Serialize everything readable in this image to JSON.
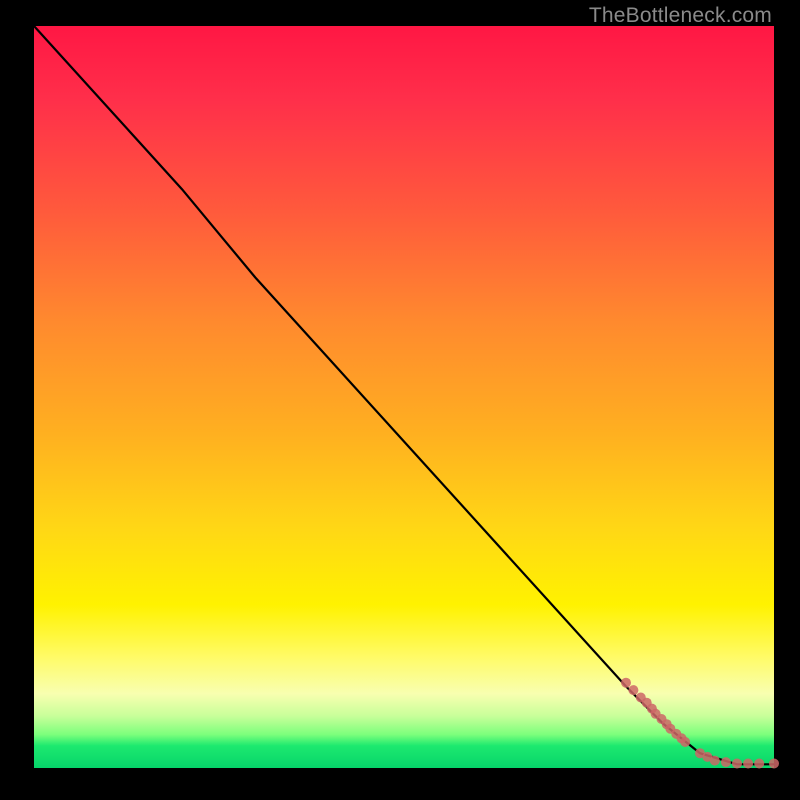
{
  "watermark": "TheBottleneck.com",
  "chart_data": {
    "type": "line",
    "title": "",
    "xlabel": "",
    "ylabel": "",
    "xlim": [
      0,
      100
    ],
    "ylim": [
      0,
      100
    ],
    "series": [
      {
        "name": "curve",
        "style": "line",
        "color": "#000000",
        "x": [
          0,
          10,
          20,
          25,
          30,
          40,
          50,
          60,
          70,
          80,
          85,
          90,
          95,
          100
        ],
        "y": [
          100,
          89,
          78,
          72,
          66,
          55,
          44,
          33,
          22,
          11,
          6,
          2,
          0.5,
          0.5
        ]
      },
      {
        "name": "points",
        "style": "scatter",
        "color": "#cc6666",
        "x": [
          80,
          81,
          82,
          82.8,
          83.5,
          84,
          84.8,
          85.5,
          86,
          86.8,
          87.5,
          88,
          90,
          91,
          92,
          93.5,
          95,
          96.5,
          98,
          100
        ],
        "y": [
          11.5,
          10.5,
          9.5,
          8.8,
          8,
          7.3,
          6.6,
          5.9,
          5.3,
          4.6,
          4,
          3.5,
          2,
          1.5,
          1,
          0.8,
          0.6,
          0.6,
          0.6,
          0.6
        ]
      }
    ]
  }
}
